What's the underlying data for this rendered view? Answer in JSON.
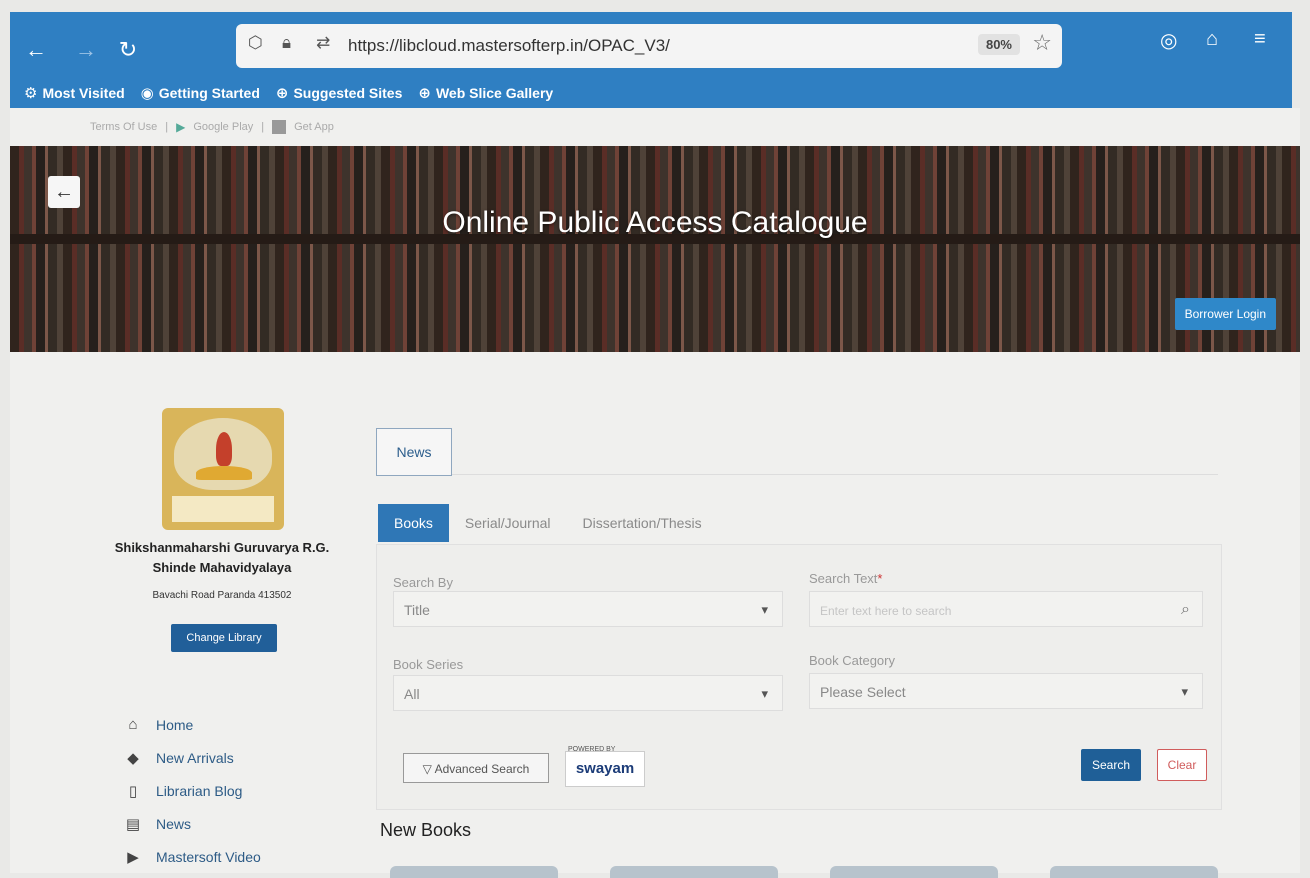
{
  "browser": {
    "url": "https://libcloud.mastersofterp.in/OPAC_V3/",
    "zoom": "80%",
    "bookmarks": [
      {
        "label": "Most Visited",
        "icon": "gear-icon"
      },
      {
        "label": "Getting Started",
        "icon": "firefox-icon"
      },
      {
        "label": "Suggested Sites",
        "icon": "globe-icon"
      },
      {
        "label": "Web Slice Gallery",
        "icon": "globe-icon"
      }
    ]
  },
  "top_links": {
    "terms": "Terms Of Use",
    "play": "Google Play",
    "app": "Get App"
  },
  "banner": {
    "title": "Online Public Access Catalogue",
    "borrower_login": "Borrower Login"
  },
  "library": {
    "name_line1": "Shikshanmaharshi Guruvarya R.G.",
    "name_line2": "Shinde Mahavidyalaya",
    "address": "Bavachi Road Paranda 413502",
    "change_label": "Change Library"
  },
  "sidebar": {
    "items": [
      {
        "label": "Home",
        "icon": "home-icon"
      },
      {
        "label": "New Arrivals",
        "icon": "diamond-icon"
      },
      {
        "label": "Librarian Blog",
        "icon": "book-icon"
      },
      {
        "label": "News",
        "icon": "document-icon"
      },
      {
        "label": "Mastersoft Video",
        "icon": "video-icon"
      }
    ]
  },
  "main": {
    "news_tab": "News",
    "tabs": [
      "Books",
      "Serial/Journal",
      "Dissertation/Thesis"
    ],
    "active_tab": "Books",
    "search_by_label": "Search By",
    "search_by_value": "Title",
    "search_text_label": "Search Text",
    "search_text_placeholder": "Enter text here to search",
    "book_series_label": "Book Series",
    "book_series_value": "All",
    "book_category_label": "Book Category",
    "book_category_value": "Please Select",
    "advanced_search": "Advanced Search",
    "swayam": "swayam",
    "swayam_small": "POWERED BY",
    "search_btn": "Search",
    "clear_btn": "Clear",
    "new_books": "New Books"
  }
}
